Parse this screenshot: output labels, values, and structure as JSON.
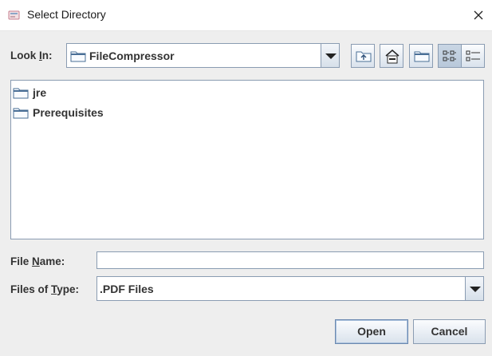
{
  "window": {
    "title": "Select Directory",
    "icon": "java-app-icon",
    "close_icon": "close-icon"
  },
  "look_in": {
    "label_prefix": "Look ",
    "label_mnemonic": "I",
    "label_suffix": "n:",
    "selected": "FileCompressor",
    "icon": "folder-icon"
  },
  "toolbar": [
    {
      "name": "up-one-level-button",
      "icon": "up-folder-icon"
    },
    {
      "name": "home-button",
      "icon": "home-icon"
    },
    {
      "name": "new-folder-button",
      "icon": "new-folder-icon"
    },
    {
      "name": "list-view-button",
      "icon": "list-view-icon",
      "pressed": true
    },
    {
      "name": "details-view-button",
      "icon": "details-view-icon",
      "pressed": false
    }
  ],
  "files": [
    {
      "name": "jre",
      "icon": "folder-icon"
    },
    {
      "name": "Prerequisites",
      "icon": "folder-icon"
    }
  ],
  "file_name": {
    "label_prefix": "File ",
    "label_mnemonic": "N",
    "label_suffix": "ame:",
    "value": ""
  },
  "file_type": {
    "label_prefix": "Files of ",
    "label_mnemonic": "T",
    "label_suffix": "ype:",
    "selected": ".PDF Files"
  },
  "buttons": {
    "open": "Open",
    "cancel": "Cancel"
  },
  "colors": {
    "background": "#eeeeee",
    "border": "#8a9cb2",
    "folder": "#4a6f96"
  }
}
